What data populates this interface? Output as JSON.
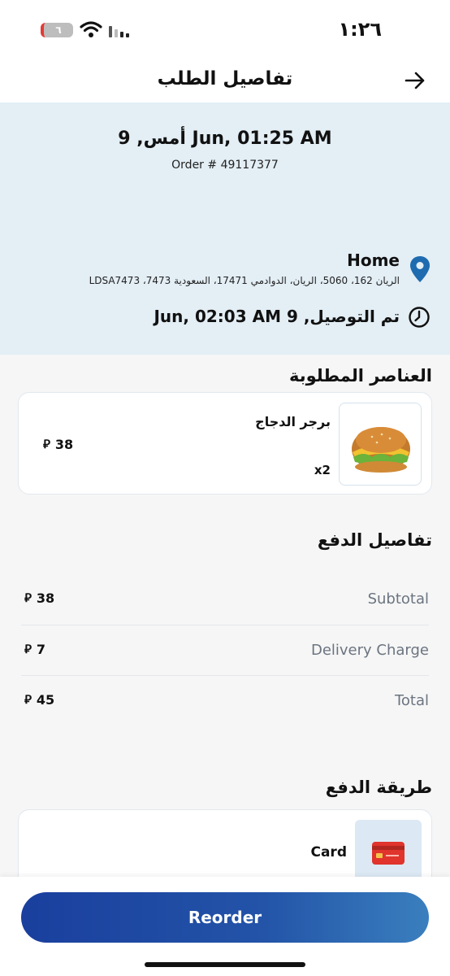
{
  "status_bar": {
    "time": "١:٢٦",
    "battery_level": "٦",
    "icons": [
      "wifi-icon",
      "signal-icon"
    ]
  },
  "header": {
    "title": "تفاصيل الطلب",
    "back_icon": "arrow-right-icon"
  },
  "order": {
    "date": "أمس, 9 Jun, 01:25 AM",
    "number": "Order # 49117377"
  },
  "address": {
    "label": "Home",
    "text": "الريان 162، 5060، الريان، الدوادمي 17471، السعودية 7473، LDSA7473",
    "icon": "location-pin-icon"
  },
  "delivery": {
    "status": "تم التوصيل, 9 Jun, 02:03 AM",
    "icon": "clock-icon"
  },
  "items_section": {
    "title": "العناصر المطلوبة",
    "items": [
      {
        "name": "برجر الدجاج",
        "quantity": "x2",
        "price": "38",
        "image_icon": "burger-image"
      }
    ]
  },
  "payment_details": {
    "title": "تفاصيل الدفع",
    "rows": [
      {
        "label": "Subtotal",
        "value": "38"
      },
      {
        "label": "Delivery Charge",
        "value": "7"
      },
      {
        "label": "Total",
        "value": "45"
      }
    ]
  },
  "payment_method": {
    "title": "طريقة الدفع",
    "label": "Card",
    "icon": "credit-card-icon"
  },
  "currency_symbol": "⃁",
  "actions": {
    "reorder_label": "Reorder"
  },
  "colors": {
    "header_bg": "#e3eef5",
    "accent_blue": "#1a3f9e",
    "pin_blue": "#1e6bb0"
  }
}
